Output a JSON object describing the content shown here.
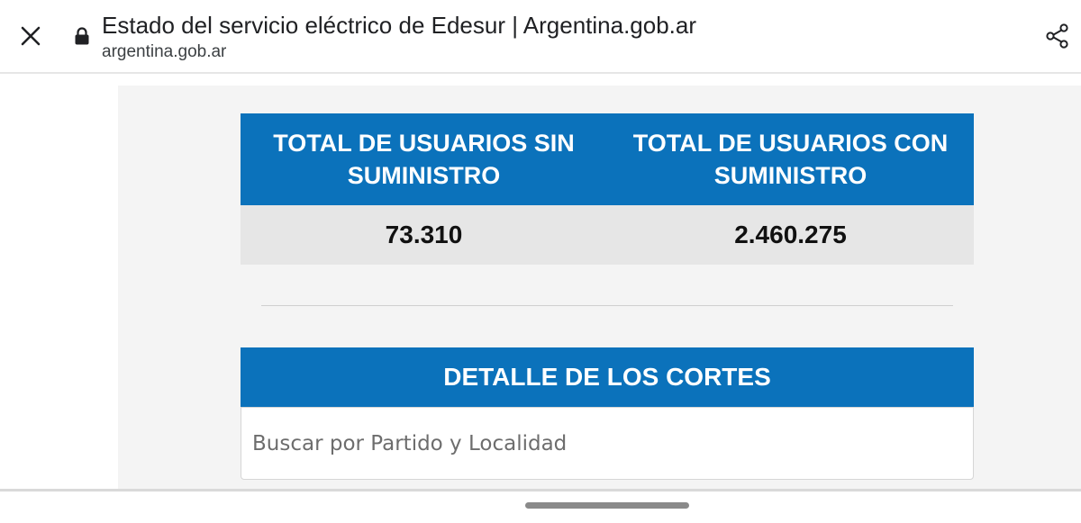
{
  "browser": {
    "title": "Estado del servicio eléctrico de Edesur | Argentina.gob.ar",
    "url": "argentina.gob.ar",
    "icons": {
      "close": "close-icon",
      "lock": "lock-icon",
      "share": "share-icon"
    }
  },
  "stats": {
    "headers": [
      "TOTAL DE USUARIOS SIN SUMINISTRO",
      "TOTAL DE USUARIOS CON SUMINISTRO"
    ],
    "values": [
      "73.310",
      "2.460.275"
    ]
  },
  "detail": {
    "title": "DETALLE DE LOS CORTES",
    "search_placeholder": "Buscar por Partido y Localidad",
    "search_value": ""
  },
  "colors": {
    "accent": "#0b72bb",
    "values_bg": "#e6e6e6",
    "panel_bg": "#f4f4f4"
  }
}
